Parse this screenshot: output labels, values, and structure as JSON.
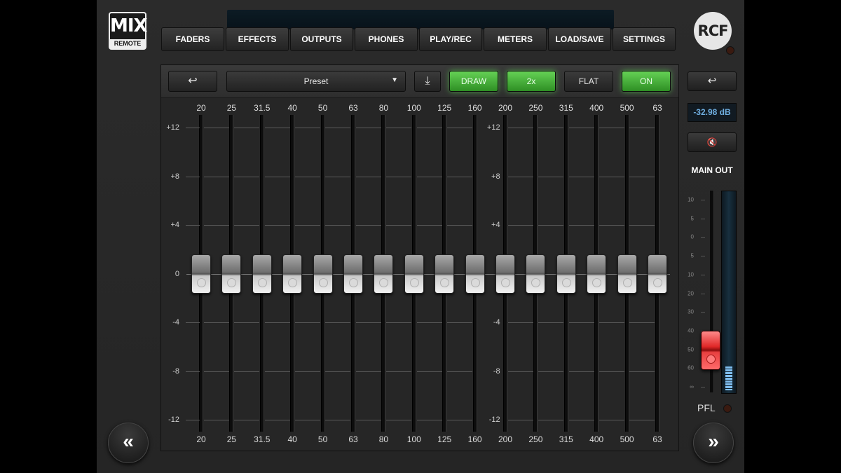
{
  "brand": {
    "logo_top": "MIX",
    "logo_bottom": "REMOTE",
    "rcf": "RCF"
  },
  "tabs": [
    {
      "label": "FADERS"
    },
    {
      "label": "EFFECTS"
    },
    {
      "label": "OUTPUTS"
    },
    {
      "label": "PHONES"
    },
    {
      "label": "PLAY/REC"
    },
    {
      "label": "METERS"
    },
    {
      "label": "LOAD/SAVE"
    },
    {
      "label": "SETTINGS"
    }
  ],
  "toolbar": {
    "back_icon": "↩",
    "preset_label": "Preset",
    "preset_arrow": "▼",
    "download_icon": "⤓",
    "draw_label": "DRAW",
    "x2_label": "2x",
    "flat_label": "FLAT",
    "on_label": "ON"
  },
  "eq": {
    "bands": [
      "20",
      "25",
      "31.5",
      "40",
      "50",
      "63",
      "80",
      "100",
      "125",
      "160",
      "200",
      "250",
      "315",
      "400",
      "500",
      "63"
    ],
    "db_labels": [
      "+12",
      "+8",
      "+4",
      "0",
      "-4",
      "-8",
      "-12"
    ],
    "db_range": [
      -12,
      12
    ],
    "band_gains_db": [
      0,
      0,
      0,
      0,
      0,
      0,
      0,
      0,
      0,
      0,
      0,
      0,
      0,
      0,
      0,
      0
    ]
  },
  "main_out": {
    "back_icon": "↩",
    "level_readout": "-32.98 dB",
    "mute_icon": "🔇",
    "title": "MAIN OUT",
    "scale": [
      "10",
      "5",
      "0",
      "5",
      "10",
      "20",
      "30",
      "40",
      "50",
      "60",
      "∞"
    ],
    "fader_level": 0.79,
    "meter_level": 0.12,
    "pfl_label": "PFL"
  },
  "nav": {
    "prev": "«",
    "next": "»"
  },
  "colors": {
    "green_active": "#4bbf3c",
    "red_fader": "#e02828",
    "readout_blue": "#6faee0"
  }
}
